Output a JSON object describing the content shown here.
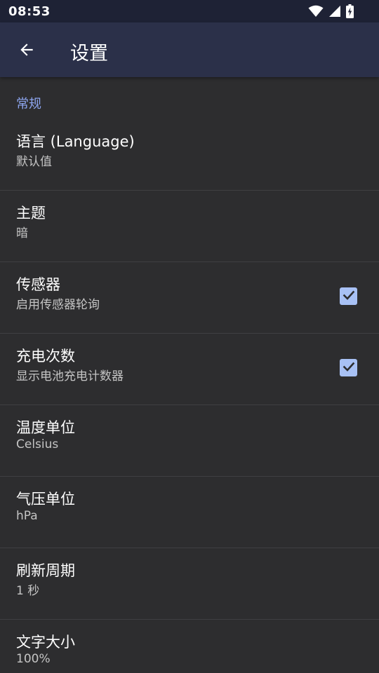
{
  "status_bar": {
    "time": "08:53",
    "icons": [
      "wifi-icon",
      "cellular-signal-icon",
      "battery-charging-icon"
    ]
  },
  "app_bar": {
    "title": "设置",
    "back_icon": "arrow-left-icon"
  },
  "colors": {
    "status_bar_bg": "#1e2235",
    "app_bar_bg": "#2b3049",
    "background": "#2d2d2f",
    "accent": "#8ea6f0",
    "checkbox": "#a8c1f5",
    "divider": "#3f3f42"
  },
  "settings": {
    "section_general": "常规",
    "items": [
      {
        "title": "语言 (Language)",
        "summary": "默认值"
      },
      {
        "title": "主题",
        "summary": "暗"
      },
      {
        "title": "传感器",
        "summary": "启用传感器轮询",
        "checked": true
      },
      {
        "title": "充电次数",
        "summary": "显示电池充电计数器",
        "checked": true
      },
      {
        "title": "温度单位",
        "summary": "Celsius"
      },
      {
        "title": "气压单位",
        "summary": "hPa"
      },
      {
        "title": "刷新周期",
        "summary": "1 秒"
      },
      {
        "title": "文字大小",
        "summary": "100%"
      }
    ]
  }
}
